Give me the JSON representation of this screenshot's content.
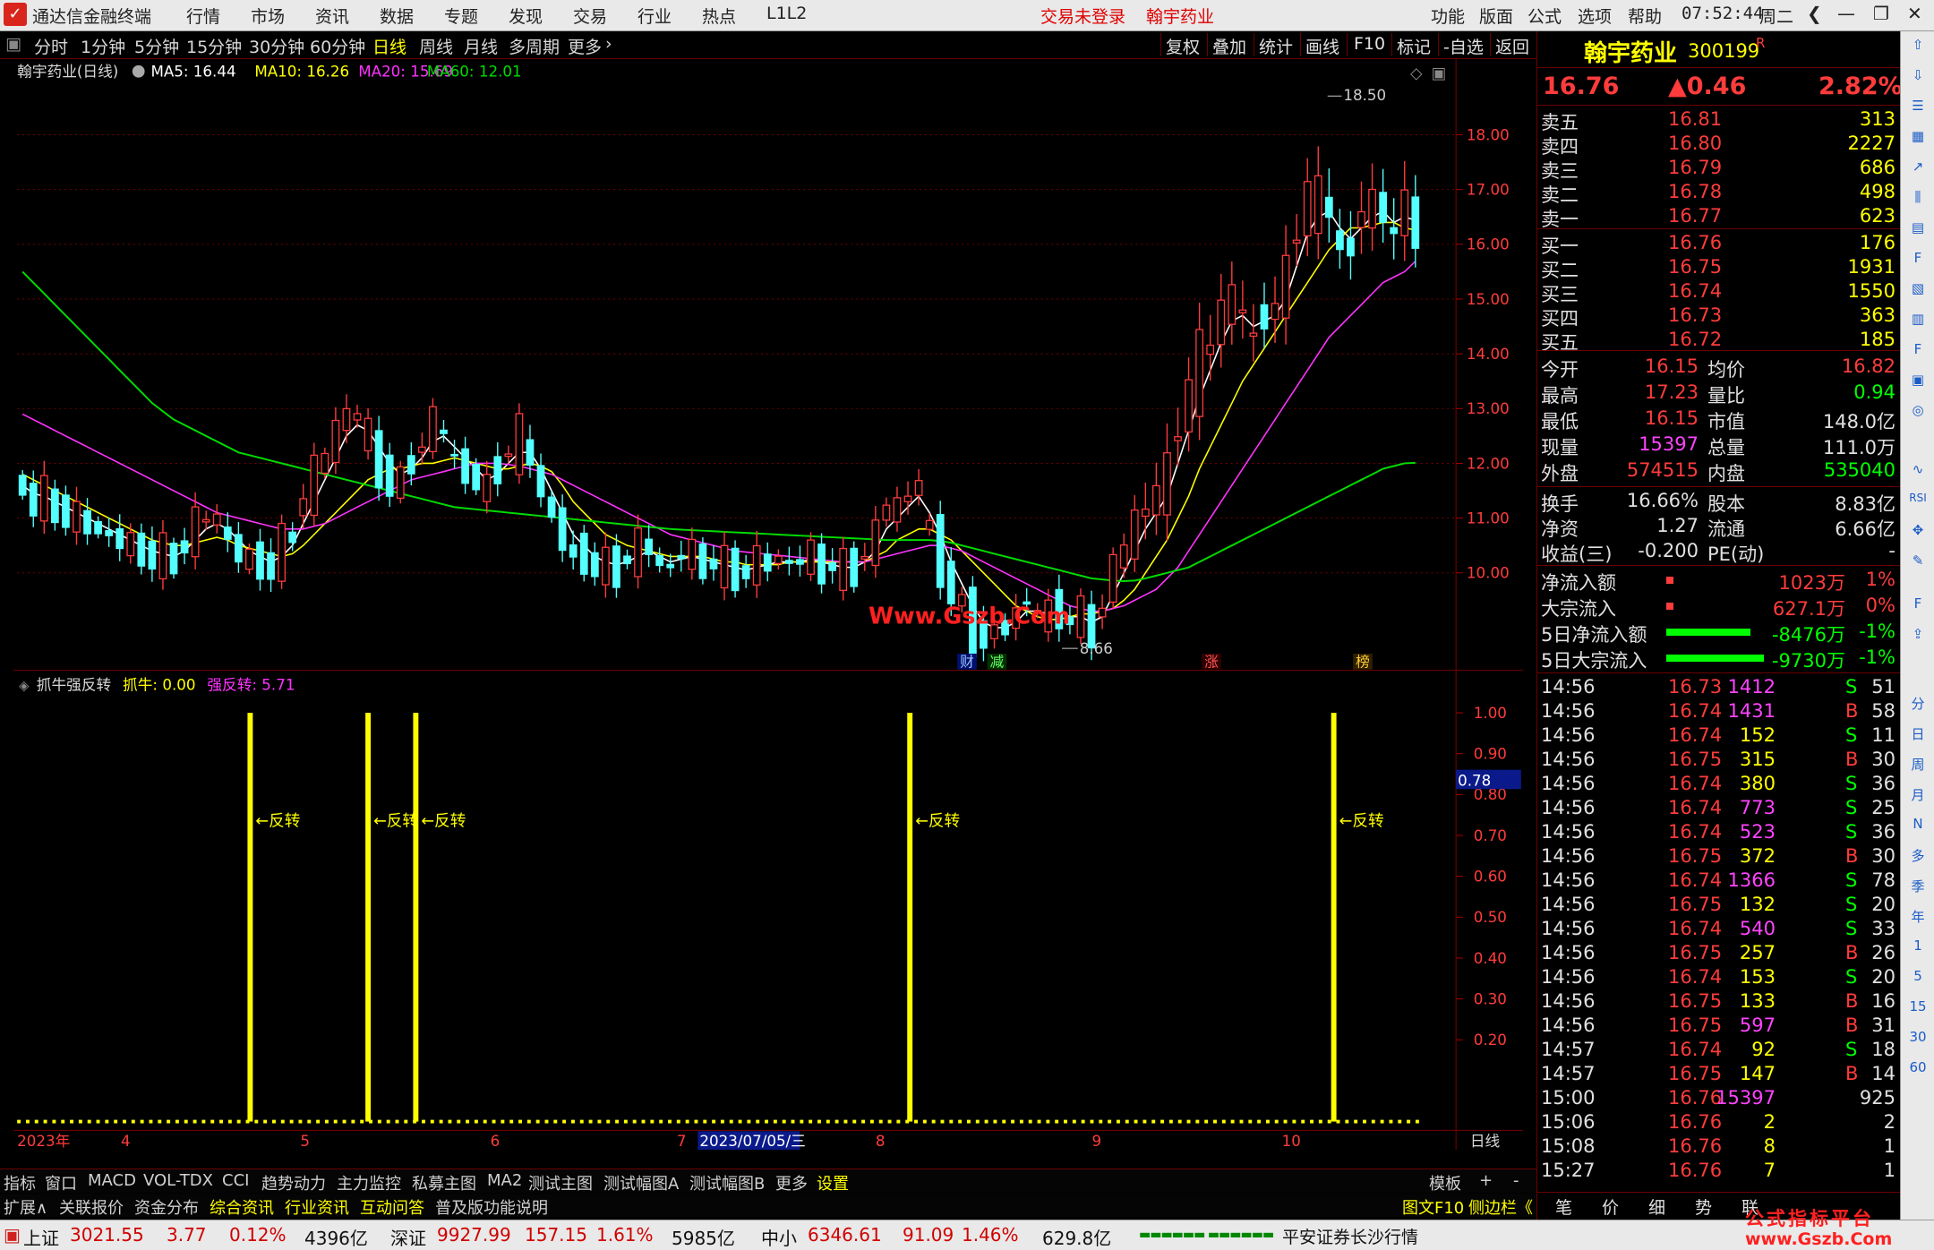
{
  "menubar": {
    "app_title": "通达信金融终端",
    "menus": [
      "行情",
      "市场",
      "资讯",
      "数据",
      "专题",
      "发现",
      "交易",
      "行业",
      "热点",
      "L1L2"
    ],
    "trade_status": "交易未登录",
    "stock_name": "翰宇药业",
    "right_menus": [
      "功能",
      "版面",
      "公式",
      "选项",
      "帮助"
    ],
    "time": "07:52:44",
    "weekday": "周二"
  },
  "toolbar": {
    "timeframes": [
      "分时",
      "1分钟",
      "5分钟",
      "15分钟",
      "30分钟",
      "60分钟",
      "日线",
      "周线",
      "月线",
      "多周期",
      "更多"
    ],
    "active": "日线",
    "right_buttons": [
      "复权",
      "叠加",
      "统计",
      "画线",
      "F10",
      "标记",
      "-自选",
      "返回"
    ]
  },
  "main_chart": {
    "title": "翰宇药业(日线)",
    "ma5": "MA5: 16.44",
    "ma10": "MA10: 16.26",
    "ma20": "MA20: 15.69",
    "ma60": "MA60: 12.01",
    "high_label": "18.50",
    "low_label": "8.66",
    "watermark": "Www.Gszb.Com",
    "event_markers": [
      "财",
      "减",
      "涨",
      "榜"
    ]
  },
  "indicator": {
    "title": "抓牛强反转",
    "v1": "抓牛: 0.00",
    "v2": "强反转: 5.71",
    "signal_label": "←反转",
    "current_value": "0.78"
  },
  "colors": {
    "up": "#ff3c3c",
    "down": "#54ffff",
    "ma5": "#ffffff",
    "ma10": "#ffff00",
    "ma20": "#ff33ff",
    "ma60": "#00dd00",
    "signal": "#ffff00",
    "grid": "#7a0000"
  },
  "chart_data": [
    {
      "type": "candlestick",
      "title": "翰宇药业(日线)",
      "ylim": [
        8.3,
        18.9
      ],
      "yticks": [
        10,
        11,
        12,
        13,
        14,
        15,
        16,
        17,
        18
      ],
      "date_axis": [
        "2023年",
        "4",
        "5",
        "6",
        "7",
        "2023/07/05/三",
        "8",
        "9",
        "10",
        "日线"
      ],
      "series": [
        {
          "name": "MA5",
          "values": [
            11.6,
            11.45,
            11.4,
            11.3,
            11.2,
            11.1,
            11.0,
            10.9,
            10.8,
            10.7,
            10.6,
            10.5,
            10.4,
            10.35,
            10.3,
            10.4,
            10.6,
            10.8,
            10.9,
            10.8,
            10.6,
            10.4,
            10.3,
            10.2,
            10.3,
            10.5,
            10.9,
            11.3,
            11.7,
            12.1,
            12.5,
            12.7,
            12.6,
            12.3,
            12.0,
            11.8,
            11.9,
            12.1,
            12.4,
            12.5,
            12.3,
            12.1,
            11.9,
            11.7,
            11.8,
            12.0,
            12.2,
            12.2,
            11.9,
            11.5,
            11.1,
            10.7,
            10.5,
            10.3,
            10.2,
            10.15,
            10.2,
            10.3,
            10.4,
            10.3,
            10.2,
            10.25,
            10.3,
            10.25,
            10.2,
            10.15,
            10.1,
            10.05,
            10.1,
            10.15,
            10.2,
            10.2,
            10.2,
            10.25,
            10.2,
            10.15,
            10.1,
            10.1,
            10.2,
            10.4,
            10.8,
            11.0,
            11.2,
            11.4,
            11.1,
            10.7,
            10.2,
            9.8,
            9.4,
            9.1,
            9.0,
            9.0,
            9.1,
            9.3,
            9.3,
            9.25,
            9.3,
            9.2,
            9.2,
            9.1,
            9.2,
            9.6,
            10.0,
            10.4,
            10.8,
            11.1,
            11.4,
            12.0,
            12.6,
            13.2,
            13.7,
            14.2,
            14.6,
            14.7,
            14.5,
            14.6,
            14.7,
            15.0,
            15.6,
            16.2,
            16.5,
            16.6,
            16.3,
            16.1,
            16.3,
            16.5,
            16.6,
            16.4,
            16.5,
            16.44
          ]
        },
        {
          "name": "MA10",
          "values": [
            11.8,
            11.7,
            11.6,
            11.5,
            11.4,
            11.3,
            11.2,
            11.1,
            11.0,
            10.9,
            10.8,
            10.7,
            10.6,
            10.55,
            10.5,
            10.5,
            10.55,
            10.6,
            10.65,
            10.6,
            10.5,
            10.45,
            10.4,
            10.35,
            10.3,
            10.35,
            10.5,
            10.7,
            10.9,
            11.1,
            11.3,
            11.5,
            11.7,
            11.8,
            11.9,
            11.9,
            11.95,
            12.0,
            12.0,
            12.05,
            12.1,
            12.05,
            12.0,
            11.95,
            11.9,
            11.9,
            11.95,
            12.0,
            11.95,
            11.85,
            11.6,
            11.3,
            11.1,
            10.9,
            10.7,
            10.6,
            10.5,
            10.45,
            10.4,
            10.35,
            10.3,
            10.3,
            10.3,
            10.3,
            10.25,
            10.2,
            10.2,
            10.15,
            10.15,
            10.15,
            10.15,
            10.2,
            10.2,
            10.2,
            10.2,
            10.2,
            10.2,
            10.2,
            10.2,
            10.3,
            10.4,
            10.6,
            10.7,
            10.8,
            10.8,
            10.7,
            10.6,
            10.4,
            10.2,
            10.0,
            9.8,
            9.6,
            9.4,
            9.3,
            9.2,
            9.15,
            9.15,
            9.2,
            9.25,
            9.25,
            9.3,
            9.35,
            9.5,
            9.7,
            10.0,
            10.3,
            10.6,
            11.0,
            11.4,
            11.9,
            12.3,
            12.7,
            13.1,
            13.5,
            13.8,
            14.1,
            14.4,
            14.7,
            15.0,
            15.3,
            15.6,
            15.9,
            16.1,
            16.3,
            16.3,
            16.35,
            16.4,
            16.4,
            16.3,
            16.26
          ]
        },
        {
          "name": "MA20",
          "values": [
            12.9,
            12.8,
            12.7,
            12.6,
            12.5,
            12.4,
            12.3,
            12.2,
            12.1,
            12.0,
            11.9,
            11.8,
            11.7,
            11.6,
            11.5,
            11.4,
            11.3,
            11.2,
            11.1,
            11.05,
            11.0,
            10.95,
            10.9,
            10.85,
            10.8,
            10.8,
            10.8,
            10.85,
            10.9,
            11.0,
            11.1,
            11.2,
            11.3,
            11.4,
            11.5,
            11.6,
            11.7,
            11.75,
            11.8,
            11.85,
            11.9,
            11.95,
            12.0,
            12.0,
            12.0,
            11.98,
            11.95,
            11.9,
            11.85,
            11.8,
            11.7,
            11.6,
            11.5,
            11.4,
            11.3,
            11.2,
            11.1,
            11.0,
            10.9,
            10.8,
            10.7,
            10.65,
            10.6,
            10.55,
            10.5,
            10.45,
            10.4,
            10.38,
            10.36,
            10.34,
            10.32,
            10.3,
            10.28,
            10.26,
            10.24,
            10.22,
            10.2,
            10.2,
            10.2,
            10.25,
            10.3,
            10.35,
            10.4,
            10.45,
            10.5,
            10.5,
            10.45,
            10.4,
            10.3,
            10.2,
            10.1,
            10.0,
            9.9,
            9.8,
            9.7,
            9.6,
            9.5,
            9.4,
            9.35,
            9.3,
            9.3,
            9.35,
            9.4,
            9.5,
            9.6,
            9.7,
            9.9,
            10.1,
            10.4,
            10.7,
            11.0,
            11.3,
            11.6,
            11.9,
            12.2,
            12.5,
            12.8,
            13.1,
            13.4,
            13.7,
            14.0,
            14.3,
            14.5,
            14.7,
            14.9,
            15.1,
            15.3,
            15.4,
            15.5,
            15.69
          ]
        },
        {
          "name": "MA60",
          "values": [
            15.5,
            15.3,
            15.1,
            14.9,
            14.7,
            14.5,
            14.3,
            14.1,
            13.9,
            13.7,
            13.5,
            13.3,
            13.1,
            12.95,
            12.8,
            12.7,
            12.6,
            12.5,
            12.4,
            12.3,
            12.2,
            12.15,
            12.1,
            12.05,
            12.0,
            11.95,
            11.9,
            11.85,
            11.8,
            11.75,
            11.7,
            11.65,
            11.6,
            11.55,
            11.5,
            11.45,
            11.4,
            11.35,
            11.3,
            11.25,
            11.2,
            11.18,
            11.16,
            11.14,
            11.12,
            11.1,
            11.08,
            11.06,
            11.04,
            11.02,
            11.0,
            10.98,
            10.96,
            10.94,
            10.92,
            10.9,
            10.88,
            10.86,
            10.84,
            10.82,
            10.8,
            10.79,
            10.78,
            10.77,
            10.76,
            10.75,
            10.74,
            10.73,
            10.72,
            10.71,
            10.7,
            10.69,
            10.68,
            10.67,
            10.66,
            10.65,
            10.64,
            10.63,
            10.62,
            10.61,
            10.6,
            10.6,
            10.6,
            10.6,
            10.6,
            10.58,
            10.55,
            10.5,
            10.45,
            10.4,
            10.35,
            10.3,
            10.25,
            10.2,
            10.15,
            10.1,
            10.05,
            10.0,
            9.95,
            9.9,
            9.88,
            9.86,
            9.85,
            9.86,
            9.9,
            9.95,
            10.0,
            10.05,
            10.1,
            10.2,
            10.3,
            10.4,
            10.5,
            10.6,
            10.7,
            10.8,
            10.9,
            11.0,
            11.1,
            11.2,
            11.3,
            11.4,
            11.5,
            11.6,
            11.7,
            11.8,
            11.9,
            11.95,
            12.0,
            12.01
          ]
        }
      ]
    },
    {
      "type": "bar",
      "title": "抓牛强反转",
      "ylim": [
        0,
        1.05
      ],
      "yticks": [
        0.2,
        0.3,
        0.4,
        0.5,
        0.6,
        0.7,
        0.8,
        0.9,
        1.0
      ],
      "signal_positions_ratio": [
        0.166,
        0.25,
        0.284,
        0.636,
        0.938
      ],
      "values": [
        1,
        1,
        1,
        1,
        1
      ]
    }
  ],
  "quote": {
    "name": "翰宇药业",
    "code": "300199",
    "mark": "R",
    "price": "16.76",
    "change": "▲0.46",
    "pct": "2.82%",
    "asks": [
      {
        "label": "卖五",
        "price": "16.81",
        "vol": "313"
      },
      {
        "label": "卖四",
        "price": "16.80",
        "vol": "2227"
      },
      {
        "label": "卖三",
        "price": "16.79",
        "vol": "686"
      },
      {
        "label": "卖二",
        "price": "16.78",
        "vol": "498"
      },
      {
        "label": "卖一",
        "price": "16.77",
        "vol": "623"
      }
    ],
    "bids": [
      {
        "label": "买一",
        "price": "16.76",
        "vol": "176"
      },
      {
        "label": "买二",
        "price": "16.75",
        "vol": "1931"
      },
      {
        "label": "买三",
        "price": "16.74",
        "vol": "1550"
      },
      {
        "label": "买四",
        "price": "16.73",
        "vol": "363"
      },
      {
        "label": "买五",
        "price": "16.72",
        "vol": "185"
      }
    ],
    "stats": [
      {
        "l1": "今开",
        "v1": "16.15",
        "l2": "均价",
        "v2": "16.82",
        "c1": "#ff3c3c",
        "c2": "#ff3c3c"
      },
      {
        "l1": "最高",
        "v1": "17.23",
        "l2": "量比",
        "v2": "0.94",
        "c1": "#ff3c3c",
        "c2": "#00ff00"
      },
      {
        "l1": "最低",
        "v1": "16.15",
        "l2": "市值",
        "v2": "148.0亿",
        "c1": "#ff3c3c",
        "c2": "#e0e0e0"
      },
      {
        "l1": "现量",
        "v1": "15397",
        "l2": "总量",
        "v2": "111.0万",
        "c1": "#ff44ff",
        "c2": "#e0e0e0"
      },
      {
        "l1": "外盘",
        "v1": "574515",
        "l2": "内盘",
        "v2": "535040",
        "c1": "#ff3c3c",
        "c2": "#00ff00"
      }
    ],
    "stats2": [
      {
        "l1": "换手",
        "v1": "16.66%",
        "l2": "股本",
        "v2": "8.83亿"
      },
      {
        "l1": "净资",
        "v1": "1.27",
        "l2": "流通",
        "v2": "6.66亿"
      },
      {
        "l1": "收益(三)",
        "v1": "-0.200",
        "l2": "PE(动)",
        "v2": "-"
      }
    ],
    "flows": [
      {
        "label": "净流入额",
        "value": "1023万",
        "pct": "1%",
        "color": "#ff3c3c",
        "bar": 0.02
      },
      {
        "label": "大宗流入",
        "value": "627.1万",
        "pct": "0%",
        "color": "#ff3c3c",
        "bar": 0.01
      },
      {
        "label": "5日净流入额",
        "value": "-8476万",
        "pct": "-1%",
        "color": "#00ff00",
        "bar": 0.36
      },
      {
        "label": "5日大宗流入",
        "value": "-9730万",
        "pct": "-1%",
        "color": "#00ff00",
        "bar": 0.42
      }
    ],
    "ticks": [
      {
        "t": "14:56",
        "p": "16.73",
        "v": "1412",
        "bs": "S",
        "n": "51"
      },
      {
        "t": "14:56",
        "p": "16.74",
        "v": "1431",
        "bs": "B",
        "n": "58"
      },
      {
        "t": "14:56",
        "p": "16.74",
        "v": "152",
        "bs": "S",
        "n": "11"
      },
      {
        "t": "14:56",
        "p": "16.75",
        "v": "315",
        "bs": "B",
        "n": "30"
      },
      {
        "t": "14:56",
        "p": "16.74",
        "v": "380",
        "bs": "S",
        "n": "36"
      },
      {
        "t": "14:56",
        "p": "16.74",
        "v": "773",
        "bs": "S",
        "n": "25"
      },
      {
        "t": "14:56",
        "p": "16.74",
        "v": "523",
        "bs": "S",
        "n": "36"
      },
      {
        "t": "14:56",
        "p": "16.75",
        "v": "372",
        "bs": "B",
        "n": "30"
      },
      {
        "t": "14:56",
        "p": "16.74",
        "v": "1366",
        "bs": "S",
        "n": "78"
      },
      {
        "t": "14:56",
        "p": "16.75",
        "v": "132",
        "bs": "S",
        "n": "20"
      },
      {
        "t": "14:56",
        "p": "16.74",
        "v": "540",
        "bs": "S",
        "n": "33"
      },
      {
        "t": "14:56",
        "p": "16.75",
        "v": "257",
        "bs": "B",
        "n": "26"
      },
      {
        "t": "14:56",
        "p": "16.74",
        "v": "153",
        "bs": "S",
        "n": "20"
      },
      {
        "t": "14:56",
        "p": "16.75",
        "v": "133",
        "bs": "B",
        "n": "16"
      },
      {
        "t": "14:56",
        "p": "16.75",
        "v": "597",
        "bs": "B",
        "n": "31"
      },
      {
        "t": "14:57",
        "p": "16.74",
        "v": "92",
        "bs": "S",
        "n": "18"
      },
      {
        "t": "14:57",
        "p": "16.75",
        "v": "147",
        "bs": "B",
        "n": "14"
      },
      {
        "t": "15:00",
        "p": "16.76",
        "v": "15397",
        "bs": "",
        "n": "925"
      },
      {
        "t": "15:06",
        "p": "16.76",
        "v": "2",
        "bs": "",
        "n": "2"
      },
      {
        "t": "15:08",
        "p": "16.76",
        "v": "8",
        "bs": "",
        "n": "1"
      },
      {
        "t": "15:27",
        "p": "16.76",
        "v": "7",
        "bs": "",
        "n": "1"
      }
    ],
    "bottom_tabs": [
      "笔",
      "价",
      "细",
      "势",
      "联"
    ]
  },
  "bottom_tabs_1": [
    "指标",
    "窗口",
    "MACD",
    "VOL-TDX",
    "CCI",
    "趋势动力",
    "主力监控",
    "私募主图",
    "MA2",
    "测试主图",
    "测试幅图A",
    "测试幅图B",
    "更多",
    "设置"
  ],
  "bottom_tabs_1_right": [
    "模板",
    "+",
    "-"
  ],
  "bottom_tabs_2": [
    "扩展∧",
    "关联报价",
    "资金分布",
    "综合资讯",
    "行业资讯",
    "互动问答",
    "普及版功能说明"
  ],
  "bottom_tabs_2_right": [
    "图文F10",
    "侧边栏《"
  ],
  "statusbar": {
    "sh_label": "上证",
    "sh_index": "3021.55",
    "sh_chg": "3.77",
    "sh_pct": "0.12%",
    "sh_amt": "4396亿",
    "sz_label": "深证",
    "sz_index": "9927.99",
    "sz_chg": "157.15",
    "sz_pct": "1.61%",
    "sz_amt": "5985亿",
    "zx_label": "中小",
    "zx_index": "6346.61",
    "zx_chg": "91.09",
    "zx_pct": "1.46%",
    "zx_amt": "629.8亿",
    "broker": "平安证券长沙行情"
  },
  "sidebar": {
    "items": [
      "分",
      "日",
      "周",
      "月",
      "N",
      "多",
      "季",
      "年",
      "1",
      "5",
      "15",
      "30",
      "60"
    ]
  },
  "site_watermark": {
    "line1": "公式指标平台",
    "line2": "www.Gszb.Com"
  }
}
